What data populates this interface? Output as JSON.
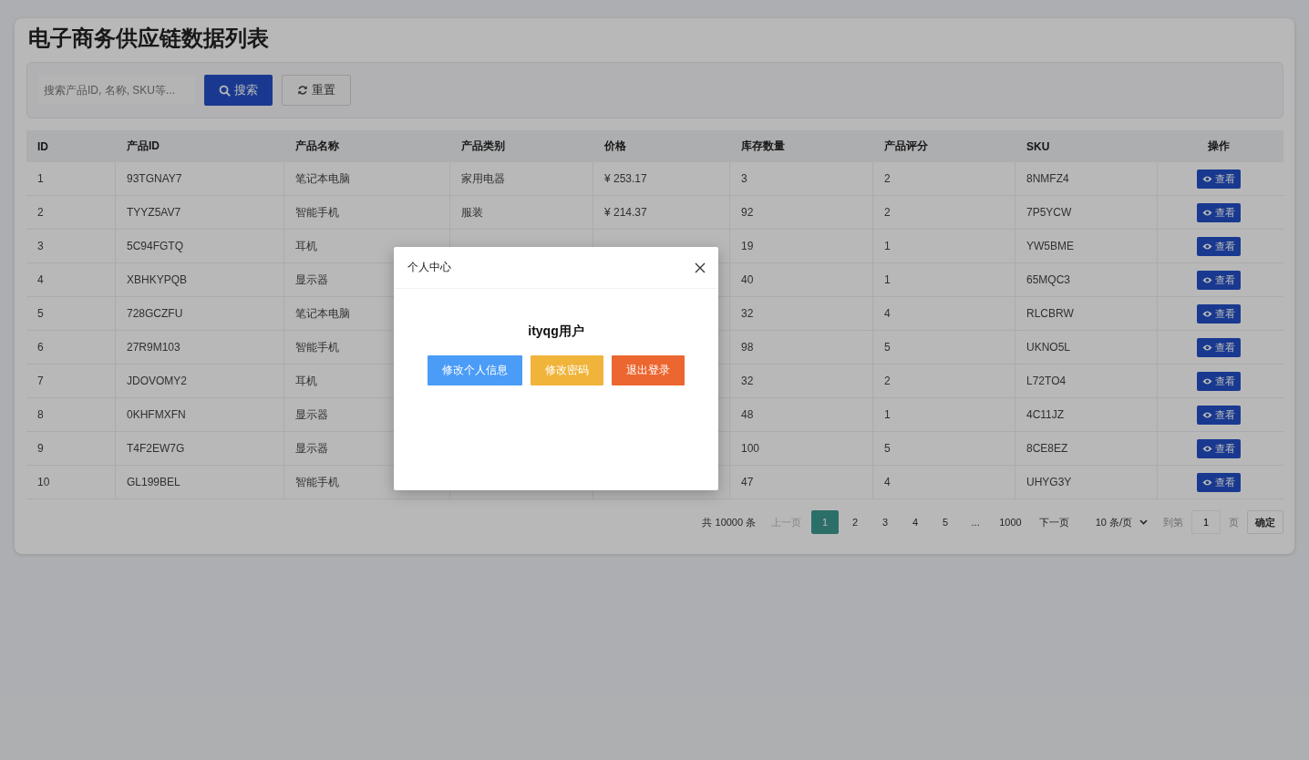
{
  "page": {
    "title": "电子商务供应链数据列表"
  },
  "search": {
    "placeholder": "搜索产品ID, 名称, SKU等...",
    "search_button": "搜索",
    "reset_button": "重置"
  },
  "table": {
    "columns": [
      "ID",
      "产品ID",
      "产品名称",
      "产品类别",
      "价格",
      "库存数量",
      "产品评分",
      "SKU",
      "操作"
    ],
    "rows": [
      {
        "id": "1",
        "product_id": "93TGNAY7",
        "name": "笔记本电脑",
        "category": "家用电器",
        "price": "¥ 253.17",
        "stock": "3",
        "rating": "2",
        "sku": "8NMFZ4",
        "action": "查看"
      },
      {
        "id": "2",
        "product_id": "TYYZ5AV7",
        "name": "智能手机",
        "category": "服装",
        "price": "¥ 214.37",
        "stock": "92",
        "rating": "2",
        "sku": "7P5YCW",
        "action": "查看"
      },
      {
        "id": "3",
        "product_id": "5C94FGTQ",
        "name": "耳机",
        "stock": "19",
        "rating": "1",
        "sku": "YW5BME",
        "action": "查看"
      },
      {
        "id": "4",
        "product_id": "XBHKYPQB",
        "name": "显示器",
        "stock": "40",
        "rating": "1",
        "sku": "65MQC3",
        "action": "查看"
      },
      {
        "id": "5",
        "product_id": "728GCZFU",
        "name": "笔记本电脑",
        "stock": "32",
        "rating": "4",
        "sku": "RLCBRW",
        "action": "查看"
      },
      {
        "id": "6",
        "product_id": "27R9M103",
        "name": "智能手机",
        "stock": "98",
        "rating": "5",
        "sku": "UKNO5L",
        "action": "查看"
      },
      {
        "id": "7",
        "product_id": "JDOVOMY2",
        "name": "耳机",
        "stock": "32",
        "rating": "2",
        "sku": "L72TO4",
        "action": "查看"
      },
      {
        "id": "8",
        "product_id": "0KHFMXFN",
        "name": "显示器",
        "stock": "48",
        "rating": "1",
        "sku": "4C11JZ",
        "action": "查看"
      },
      {
        "id": "9",
        "product_id": "T4F2EW7G",
        "name": "显示器",
        "stock": "100",
        "rating": "5",
        "sku": "8CE8EZ",
        "action": "查看"
      },
      {
        "id": "10",
        "product_id": "GL199BEL",
        "name": "智能手机",
        "stock": "47",
        "rating": "4",
        "sku": "UHYG3Y",
        "action": "查看"
      }
    ]
  },
  "pagination": {
    "total": "共 10000 条",
    "prev": {
      "label": "上一页",
      "disabled": true
    },
    "pages": [
      {
        "label": "1",
        "selected": true
      },
      {
        "label": "2",
        "selected": false
      },
      {
        "label": "3",
        "selected": false
      },
      {
        "label": "4",
        "selected": false
      },
      {
        "label": "5",
        "selected": false
      },
      {
        "label": "...",
        "selected": false
      },
      {
        "label": "1000",
        "selected": false
      }
    ],
    "next": {
      "label": "下一页",
      "disabled": false
    },
    "page_size": "10 条/页",
    "goto_label": "到第",
    "goto_value": "1",
    "page_unit": "页",
    "confirm": "确定"
  },
  "modal": {
    "title": "个人中心",
    "user": "ityqg用户",
    "buttons": [
      {
        "label": "修改个人信息",
        "color": "#4a9cf6"
      },
      {
        "label": "修改密码",
        "color": "#f0b43a"
      },
      {
        "label": "退出登录",
        "color": "#ec6630"
      }
    ]
  }
}
